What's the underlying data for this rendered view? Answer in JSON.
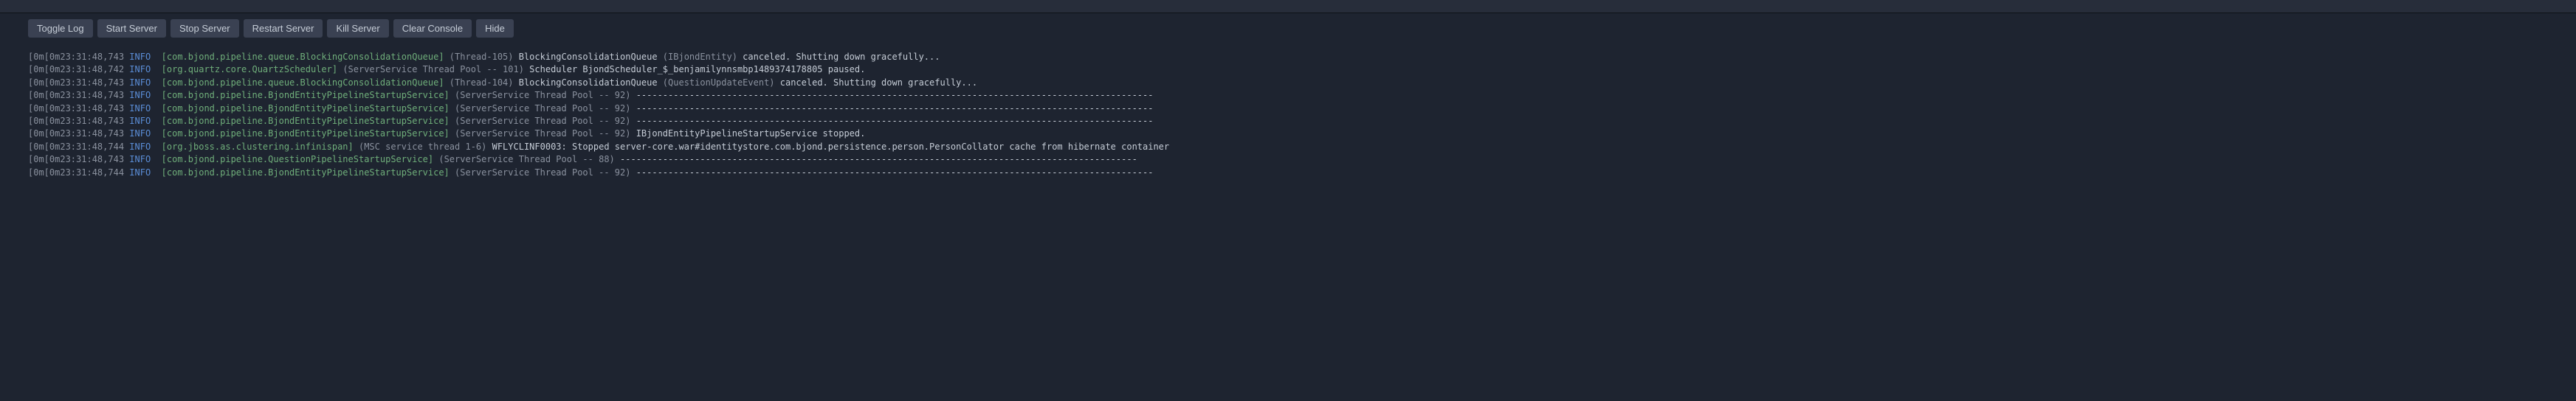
{
  "toolbar": {
    "toggle_log": "Toggle Log",
    "start_server": "Start Server",
    "stop_server": "Stop Server",
    "restart_server": "Restart Server",
    "kill_server": "Kill Server",
    "clear_console": "Clear Console",
    "hide": "Hide"
  },
  "logs": [
    {
      "prefix": "[0m[0m",
      "timestamp": "23:31:48,743",
      "level": "INFO",
      "logger": "[com.bjond.pipeline.queue.BlockingConsolidationQueue]",
      "thread": "(Thread-105)",
      "msg_white": "BlockingConsolidationQueue",
      "msg_dim_mid": " (IBjondEntity) ",
      "msg_white2": "canceled. Shutting down gracefully..."
    },
    {
      "prefix": "[0m[0m",
      "timestamp": "23:31:48,742",
      "level": "INFO",
      "logger": "[org.quartz.core.QuartzScheduler]",
      "thread": "(ServerService Thread Pool -- 101)",
      "msg_white": " Scheduler BjondScheduler_$_benjamilynnsmbp1489374178805 paused."
    },
    {
      "prefix": "[0m[0m",
      "timestamp": "23:31:48,743",
      "level": "INFO",
      "logger": "[com.bjond.pipeline.queue.BlockingConsolidationQueue]",
      "thread": "(Thread-104)",
      "msg_white": "BlockingConsolidationQueue",
      "msg_dim_mid": " (QuestionUpdateEvent) ",
      "msg_white2": "canceled. Shutting down gracefully..."
    },
    {
      "prefix": "[0m[0m",
      "timestamp": "23:31:48,743",
      "level": "INFO",
      "logger": "[com.bjond.pipeline.BjondEntityPipelineStartupService]",
      "thread": "(ServerService Thread Pool -- 92)",
      "msg_white": "-------------------------------------------------------------------------------------------------"
    },
    {
      "prefix": "[0m[0m",
      "timestamp": "23:31:48,743",
      "level": "INFO",
      "logger": "[com.bjond.pipeline.BjondEntityPipelineStartupService]",
      "thread": "(ServerService Thread Pool -- 92)",
      "msg_white": "-------------------------------------------------------------------------------------------------"
    },
    {
      "prefix": "[0m[0m",
      "timestamp": "23:31:48,743",
      "level": "INFO",
      "logger": "[com.bjond.pipeline.BjondEntityPipelineStartupService]",
      "thread": "(ServerService Thread Pool -- 92)",
      "msg_white": "-------------------------------------------------------------------------------------------------"
    },
    {
      "prefix": "[0m[0m",
      "timestamp": "23:31:48,743",
      "level": "INFO",
      "logger": "[com.bjond.pipeline.BjondEntityPipelineStartupService]",
      "thread": "(ServerService Thread Pool -- 92)",
      "msg_white": "IBjondEntityPipelineStartupService stopped."
    },
    {
      "prefix": "[0m[0m",
      "timestamp": "23:31:48,744",
      "level": "INFO",
      "logger": "[org.jboss.as.clustering.infinispan]",
      "thread": "(MSC service thread 1-6)",
      "msg_white": "WFLYCLINF0003: Stopped server-core.war#identitystore.com.bjond.persistence.person.PersonCollator cache from hibernate container"
    },
    {
      "prefix": "[0m[0m",
      "timestamp": "23:31:48,743",
      "level": "INFO",
      "logger": "[com.bjond.pipeline.QuestionPipelineStartupService]",
      "thread": "(ServerService Thread Pool -- 88)",
      "msg_white": "-------------------------------------------------------------------------------------------------"
    },
    {
      "prefix": "[0m[0m",
      "timestamp": "23:31:48,744",
      "level": "INFO",
      "logger": "[com.bjond.pipeline.BjondEntityPipelineStartupService]",
      "thread": "(ServerService Thread Pool -- 92)",
      "msg_white": "-------------------------------------------------------------------------------------------------"
    }
  ]
}
